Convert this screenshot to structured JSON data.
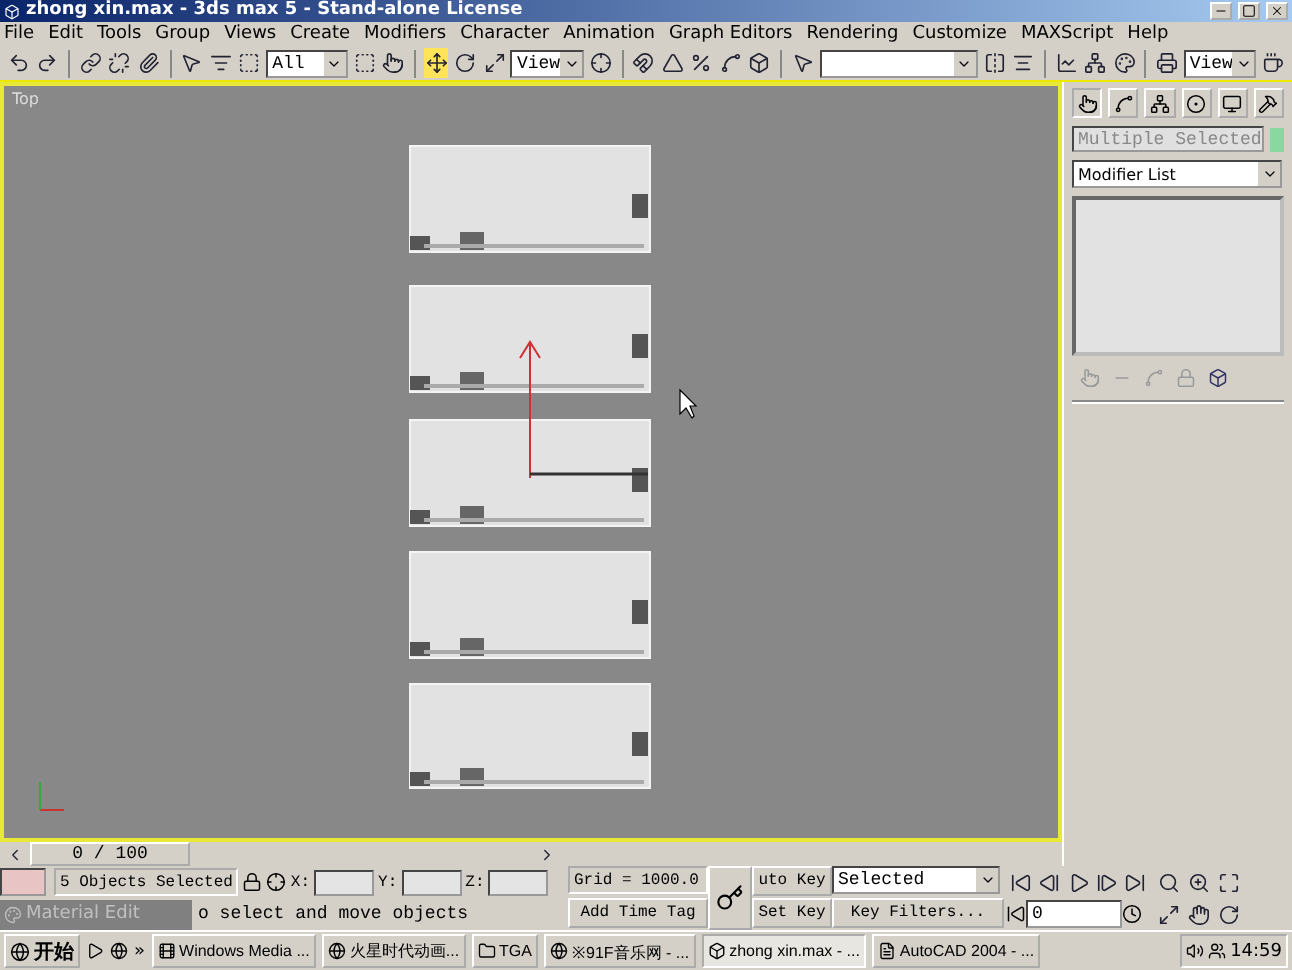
{
  "window": {
    "title": "zhong xin.max - 3ds max 5 - Stand-alone License"
  },
  "menu": [
    "File",
    "Edit",
    "Tools",
    "Group",
    "Views",
    "Create",
    "Modifiers",
    "Character",
    "Animation",
    "Graph Editors",
    "Rendering",
    "Customize",
    "MAXScript",
    "Help"
  ],
  "toolbar": {
    "selection_filter": "All",
    "coordinate_system": "View",
    "render_type": "View"
  },
  "viewport": {
    "label": "Top",
    "active": true
  },
  "command_panel": {
    "object_name": "Multiple Selected",
    "modifier_list": "Modifier List"
  },
  "time_slider": {
    "reading": "0 / 100",
    "level": 0
  },
  "status": {
    "selection": "5 Objects Selected",
    "x_label": "X:",
    "y_label": "Y:",
    "z_label": "Z:",
    "grid": "Grid = 1000.0",
    "prompt": "o select and move objects",
    "add_time_tag": "Add Time Tag",
    "auto_key": "uto Key",
    "auto_key_mode": "Selected",
    "set_key": "Set Key",
    "key_filters": "Key Filters...",
    "frame": "0"
  },
  "minimized_window": {
    "title": "Material Edit"
  },
  "taskbar": {
    "start": "开始",
    "more": "»",
    "clock": "14:59",
    "buttons": [
      {
        "label": "Windows Media ...",
        "selected": false
      },
      {
        "label": "火星时代动画...",
        "selected": false
      },
      {
        "label": "TGA",
        "selected": false
      },
      {
        "label": "※91F音乐网 - ...",
        "selected": false
      },
      {
        "label": "zhong xin.max - ...",
        "selected": true
      },
      {
        "label": "AutoCAD 2004 - ...",
        "selected": false
      }
    ]
  }
}
